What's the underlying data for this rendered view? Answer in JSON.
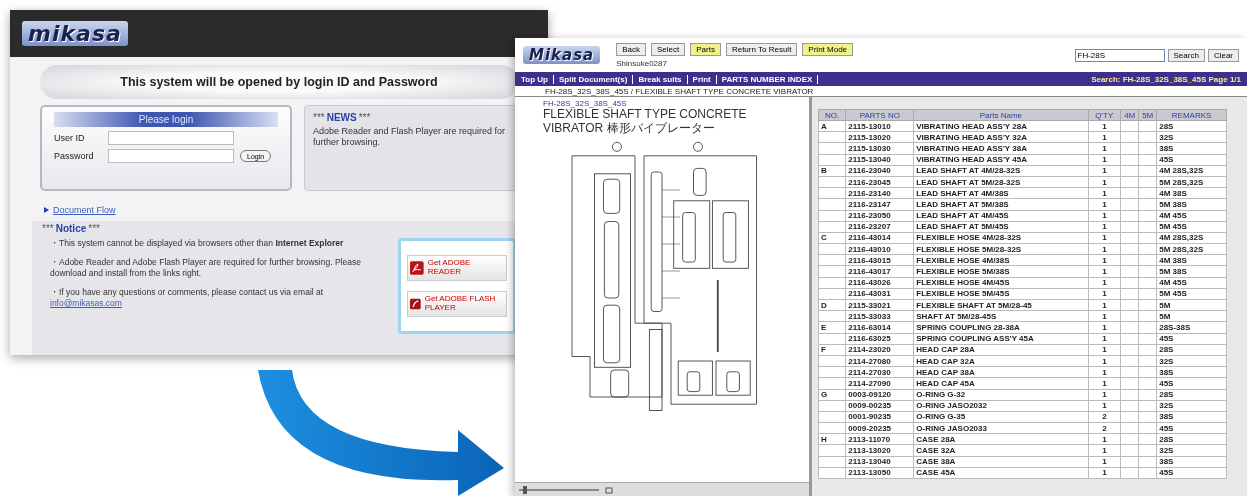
{
  "login_page": {
    "logo": "mikasa",
    "heading": "This system will be opened by login ID and Password",
    "login_box": {
      "title": "Please login",
      "fields": [
        {
          "label": "User ID"
        },
        {
          "label": "Password"
        }
      ],
      "button": "Login"
    },
    "news": {
      "title": "NEWS",
      "stars": "***",
      "text": "Adobe Reader and Flash Player are required for further browsing."
    },
    "link": "Document Flow",
    "notice": {
      "title": "Notice",
      "stars": "***",
      "paragraphs": [
        "・This system cannot be displayed via browsers other than **Internet Explorer**",
        "・Adobe Reader and Adobe Flash Player are required for further browsing. Please download and install from the links right.",
        "・If you have any questions or comments, please contact us via email at"
      ],
      "email": "info@mikasas.com",
      "downloads": [
        {
          "kind": "reader",
          "label": "Get ADOBE READER"
        },
        {
          "kind": "flash",
          "label": "Get ADOBE FLASH PLAYER"
        }
      ]
    }
  },
  "parts_page": {
    "logo": "Mikasa",
    "top_buttons": [
      {
        "label": "Back",
        "highlight": false
      },
      {
        "label": "Select",
        "highlight": false
      },
      {
        "label": "Parts",
        "highlight": true
      },
      {
        "label": "Return To Result",
        "highlight": false
      },
      {
        "label": "Print Mode",
        "highlight": true
      }
    ],
    "user": "Shinsuke0287",
    "search": {
      "value": "FH-28S",
      "buttons": [
        "Search",
        "Clear"
      ]
    },
    "nav": [
      "Top Up",
      "Split Document(s)",
      "Break suits",
      "Print",
      "PARTS NUMBER INDEX"
    ],
    "nav_status": "Search: FH-28S_32S_38S_45S  Page 1/1",
    "path": "FH-28S_32S_38S_45S / FLEXIBLE SHAFT TYPE CONCRETE VIBRATOR",
    "drawing_title": "FH-28S_32S_38S_45S",
    "drawing_subtitle": "FLEXIBLE SHAFT TYPE CONCRETE VIBRATOR 棒形バイブレーター",
    "table": {
      "columns": [
        "NO.",
        "PARTS NO",
        "Parts Name",
        "Q'TY",
        "4M",
        "5M",
        "REMARKS"
      ],
      "rows": [
        {
          "no": "A",
          "part_no": "2115-13010",
          "name": "VIBRATING HEAD ASS'Y 28A",
          "qty": "1",
          "remarks": "28S"
        },
        {
          "no": "",
          "part_no": "2115-13020",
          "name": "VIBRATING HEAD ASS'Y 32A",
          "qty": "1",
          "remarks": "32S"
        },
        {
          "no": "",
          "part_no": "2115-13030",
          "name": "VIBRATING HEAD ASS'Y 38A",
          "qty": "1",
          "remarks": "38S"
        },
        {
          "no": "",
          "part_no": "2115-13040",
          "name": "VIBRATING HEAD ASS'Y 45A",
          "qty": "1",
          "remarks": "45S"
        },
        {
          "no": "B",
          "part_no": "2116-23040",
          "name": "LEAD SHAFT AT 4M/28-32S",
          "qty": "1",
          "remarks": "4M 28S,32S"
        },
        {
          "no": "",
          "part_no": "2116-23045",
          "name": "LEAD SHAFT AT 5M/28-32S",
          "qty": "1",
          "remarks": "5M 28S,32S"
        },
        {
          "no": "",
          "part_no": "2116-23140",
          "name": "LEAD SHAFT AT 4M/38S",
          "qty": "1",
          "remarks": "4M 38S"
        },
        {
          "no": "",
          "part_no": "2116-23147",
          "name": "LEAD SHAFT AT 5M/38S",
          "qty": "1",
          "remarks": "5M 38S"
        },
        {
          "no": "",
          "part_no": "2116-23050",
          "name": "LEAD SHAFT AT 4M/45S",
          "qty": "1",
          "remarks": "4M 45S"
        },
        {
          "no": "",
          "part_no": "2116-23207",
          "name": "LEAD SHAFT AT 5M/45S",
          "qty": "1",
          "remarks": "5M 45S"
        },
        {
          "no": "C",
          "part_no": "2116-43014",
          "name": "FLEXIBLE HOSE 4M/28-32S",
          "qty": "1",
          "remarks": "4M 28S,32S"
        },
        {
          "no": "",
          "part_no": "2116-43010",
          "name": "FLEXIBLE HOSE 5M/28-32S",
          "qty": "1",
          "remarks": "5M 28S,32S"
        },
        {
          "no": "",
          "part_no": "2116-43015",
          "name": "FLEXIBLE HOSE 4M/38S",
          "qty": "1",
          "remarks": "4M 38S"
        },
        {
          "no": "",
          "part_no": "2116-43017",
          "name": "FLEXIBLE HOSE 5M/38S",
          "qty": "1",
          "remarks": "5M 38S"
        },
        {
          "no": "",
          "part_no": "2116-43026",
          "name": "FLEXIBLE HOSE 4M/45S",
          "qty": "1",
          "remarks": "4M 45S"
        },
        {
          "no": "",
          "part_no": "2116-43031",
          "name": "FLEXIBLE HOSE 5M/45S",
          "qty": "1",
          "remarks": "5M 45S"
        },
        {
          "no": "D",
          "part_no": "2115-33021",
          "name": "FLEXIBLE SHAFT AT 5M/28-45",
          "qty": "1",
          "remarks": "5M"
        },
        {
          "no": "",
          "part_no": "2115-33033",
          "name": "SHAFT AT 5M/28-45S",
          "qty": "1",
          "remarks": "5M"
        },
        {
          "no": "E",
          "part_no": "2116-63014",
          "name": "SPRING COUPLING 28-38A",
          "qty": "1",
          "remarks": "28S-38S"
        },
        {
          "no": "",
          "part_no": "2116-63025",
          "name": "SPRING COUPLING ASS'Y 45A",
          "qty": "1",
          "remarks": "45S"
        },
        {
          "no": "F",
          "part_no": "2114-23020",
          "name": "HEAD CAP 28A",
          "qty": "1",
          "remarks": "28S"
        },
        {
          "no": "",
          "part_no": "2114-27080",
          "name": "HEAD CAP 32A",
          "qty": "1",
          "remarks": "32S"
        },
        {
          "no": "",
          "part_no": "2114-27030",
          "name": "HEAD CAP 38A",
          "qty": "1",
          "remarks": "38S"
        },
        {
          "no": "",
          "part_no": "2114-27090",
          "name": "HEAD CAP 45A",
          "qty": "1",
          "remarks": "45S"
        },
        {
          "no": "G",
          "part_no": "0003-09120",
          "name": "O-RING G-32",
          "qty": "1",
          "remarks": "28S"
        },
        {
          "no": "",
          "part_no": "0009-00235",
          "name": "O-RING JASO2032",
          "qty": "1",
          "remarks": "32S"
        },
        {
          "no": "",
          "part_no": "0001-90235",
          "name": "O-RING G-35",
          "qty": "2",
          "remarks": "38S"
        },
        {
          "no": "",
          "part_no": "0009-20235",
          "name": "O-RING JASO2033",
          "qty": "2",
          "remarks": "45S"
        },
        {
          "no": "H",
          "part_no": "2113-11070",
          "name": "CASE 28A",
          "qty": "1",
          "remarks": "28S"
        },
        {
          "no": "",
          "part_no": "2113-13020",
          "name": "CASE 32A",
          "qty": "1",
          "remarks": "32S"
        },
        {
          "no": "",
          "part_no": "2113-13040",
          "name": "CASE 38A",
          "qty": "1",
          "remarks": "38S"
        },
        {
          "no": "",
          "part_no": "2113-13050",
          "name": "CASE 45A",
          "qty": "1",
          "remarks": "45S"
        }
      ]
    }
  }
}
